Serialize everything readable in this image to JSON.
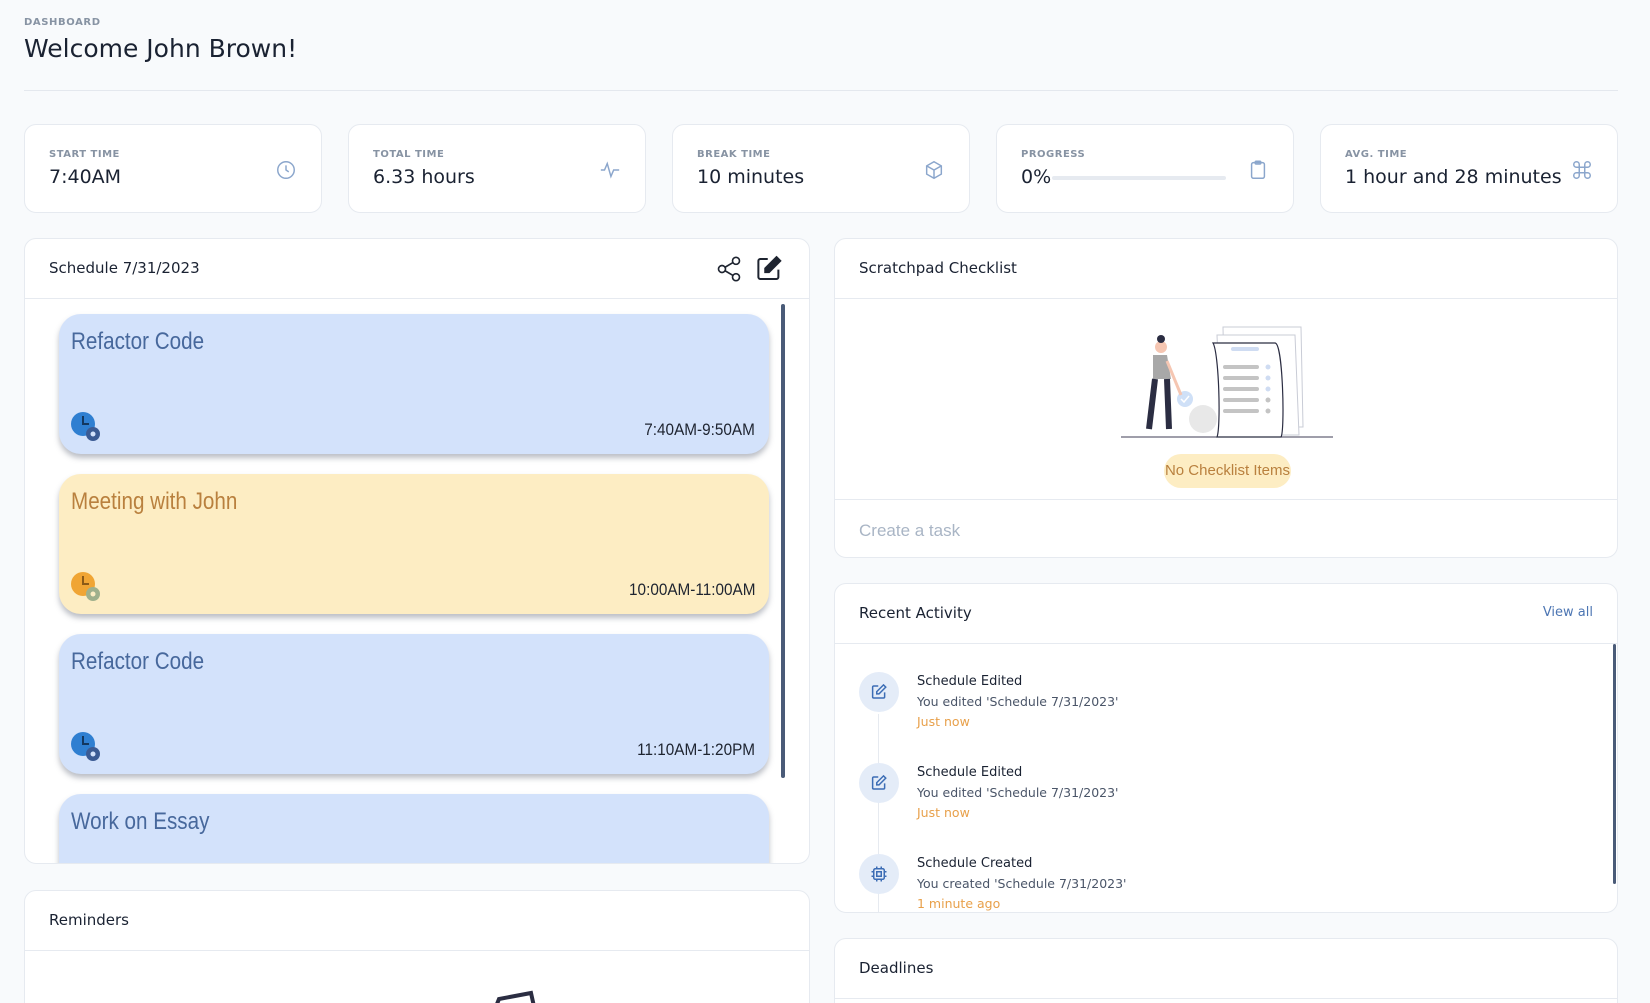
{
  "header": {
    "overline": "DASHBOARD",
    "title": "Welcome John Brown!"
  },
  "stats": [
    {
      "label": "START TIME",
      "value": "7:40AM",
      "icon": "clock-icon"
    },
    {
      "label": "TOTAL TIME",
      "value": "6.33 hours",
      "icon": "activity-icon"
    },
    {
      "label": "BREAK TIME",
      "value": "10 minutes",
      "icon": "box-icon"
    },
    {
      "label": "PROGRESS",
      "value": "0%",
      "progress": 0,
      "icon": "clipboard-icon"
    },
    {
      "label": "AVG. TIME",
      "value": "1 hour and 28 minutes",
      "icon": "command-icon"
    }
  ],
  "schedule": {
    "title": "Schedule 7/31/2023",
    "events": [
      {
        "title": "Refactor Code",
        "time": "7:40AM-9:50AM",
        "color": "#d3e2fb",
        "icon": "clock-gear-icon"
      },
      {
        "title": "Meeting with John",
        "time": "10:00AM-11:00AM",
        "color": "#fdedc3",
        "icon": "clock-gear-icon"
      },
      {
        "title": "Refactor Code",
        "time": "11:10AM-1:20PM",
        "color": "#d3e2fb",
        "icon": "clock-gear-icon"
      },
      {
        "title": "Work on Essay",
        "time": "",
        "color": "#d3e2fb",
        "icon": "clock-gear-icon"
      }
    ]
  },
  "checklist": {
    "title": "Scratchpad Checklist",
    "empty_label": "No Checklist Items",
    "input_placeholder": "Create a task"
  },
  "activity": {
    "title": "Recent Activity",
    "view_all": "View all",
    "items": [
      {
        "title": "Schedule Edited",
        "desc": "You edited 'Schedule 7/31/2023'",
        "time": "Just now",
        "icon": "edit-icon"
      },
      {
        "title": "Schedule Edited",
        "desc": "You edited 'Schedule 7/31/2023'",
        "time": "Just now",
        "icon": "edit-icon"
      },
      {
        "title": "Schedule Created",
        "desc": "You created 'Schedule 7/31/2023'",
        "time": "1 minute ago",
        "icon": "cpu-icon"
      }
    ]
  },
  "reminders": {
    "title": "Reminders"
  },
  "deadlines": {
    "title": "Deadlines"
  },
  "colors": {
    "accent": "#4d76b3",
    "event_blue": "#d3e2fb",
    "event_yellow": "#fdedc3",
    "time_orange": "#e8a04a"
  }
}
